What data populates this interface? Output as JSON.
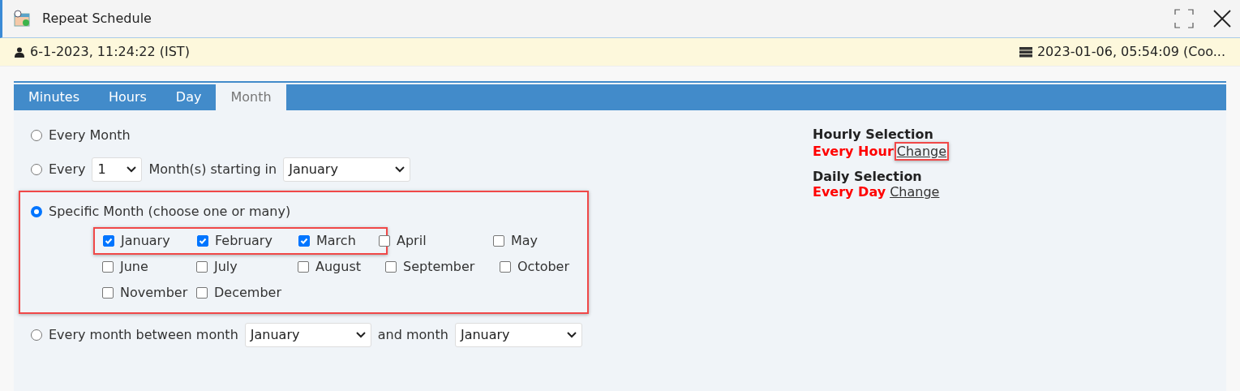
{
  "window": {
    "title": "Repeat Schedule"
  },
  "info_bar": {
    "user_time": "6-1-2023, 11:24:22 (IST)",
    "server_time": "2023-01-06, 05:54:09 (Coo..."
  },
  "tabs": [
    {
      "label": "Minutes",
      "selected": false
    },
    {
      "label": "Hours",
      "selected": false
    },
    {
      "label": "Day",
      "selected": false
    },
    {
      "label": "Month",
      "selected": true
    }
  ],
  "options": [
    {
      "kind": "plain",
      "selected": false,
      "highlighted": false,
      "label": "Every Month"
    },
    {
      "kind": "interval",
      "selected": false,
      "highlighted": false,
      "label": "Every",
      "count": "1",
      "middle": "Month(s) starting in",
      "start": "January"
    },
    {
      "kind": "specific",
      "selected": true,
      "highlighted": true,
      "label": "Specific Month (choose one or many)",
      "rows": [
        [
          {
            "highlighted": true,
            "months": [
              {
                "label": "January",
                "checked": true
              },
              {
                "label": "February",
                "checked": true
              },
              {
                "label": "March",
                "checked": true
              }
            ]
          },
          {
            "highlighted": false,
            "months": [
              {
                "label": "April",
                "checked": false
              },
              {
                "label": "May",
                "checked": false
              }
            ]
          }
        ],
        [
          {
            "highlighted": false,
            "months": [
              {
                "label": "June",
                "checked": false
              },
              {
                "label": "July",
                "checked": false
              },
              {
                "label": "August",
                "checked": false
              },
              {
                "label": "September",
                "checked": false
              },
              {
                "label": "October",
                "checked": false
              }
            ]
          }
        ],
        [
          {
            "highlighted": false,
            "months": [
              {
                "label": "November",
                "checked": false
              },
              {
                "label": "December",
                "checked": false
              }
            ]
          }
        ]
      ]
    },
    {
      "kind": "range",
      "selected": false,
      "highlighted": false,
      "label": "Every month between month",
      "from": "January",
      "middle": "and month",
      "to": "January"
    }
  ],
  "summary": [
    {
      "heading": "Hourly Selection",
      "value": "Every Hour",
      "link": "Change",
      "highlighted": true
    },
    {
      "heading": "Daily Selection",
      "value": "Every Day",
      "link": "Change",
      "highlighted": false
    }
  ]
}
